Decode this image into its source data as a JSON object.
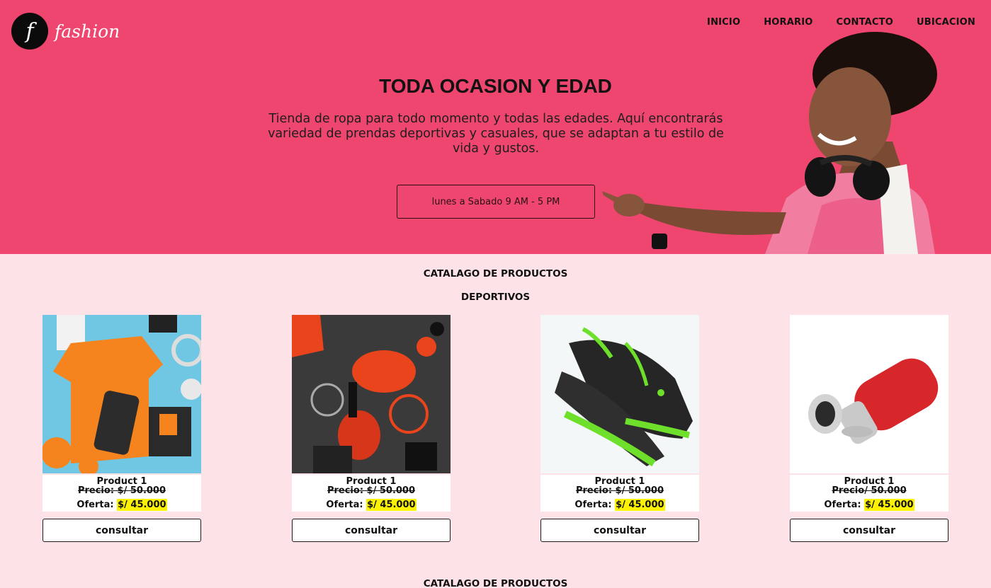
{
  "brand": {
    "logo_letter": "f",
    "name": "fashion"
  },
  "nav": [
    "INICIO",
    "HORARIO",
    "CONTACTO",
    "UBICACION"
  ],
  "hero": {
    "title": "TODA OCASION Y EDAD",
    "description": "Tienda de ropa para todo momento y todas las edades. Aquí encontrarás variedad de prendas deportivas y casuales, que se adaptan a tu estilo de vida y gustos.",
    "hours": "lunes a Sabado 9 AM - 5 PM"
  },
  "catalog": {
    "title": "CATALAGO DE PRODUCTOS",
    "category": "DEPORTIVOS",
    "products": [
      {
        "name": "Product 1",
        "old_price": "Precio: $/ 50.000",
        "offer_label": "Oferta:",
        "offer_price": "$/ 45.000",
        "button": "consultar"
      },
      {
        "name": "Product 1",
        "old_price": "Precio: $/ 50.000",
        "offer_label": "Oferta:",
        "offer_price": "$/ 45.000",
        "button": "consultar"
      },
      {
        "name": "Product 1",
        "old_price": "Precio: $/ 50.000",
        "offer_label": "Oferta:",
        "offer_price": "$/ 45.000",
        "button": "consultar"
      },
      {
        "name": "Product 1",
        "old_price": "Precio/ 50.000",
        "offer_label": "Oferta:",
        "offer_price": "$/ 45.000",
        "button": "consultar"
      }
    ],
    "next_title": "CATALAGO DE PRODUCTOS"
  },
  "colors": {
    "hero_bg": "#ee466e",
    "page_bg": "#fde3e8",
    "offer_highlight": "#fdf300"
  }
}
